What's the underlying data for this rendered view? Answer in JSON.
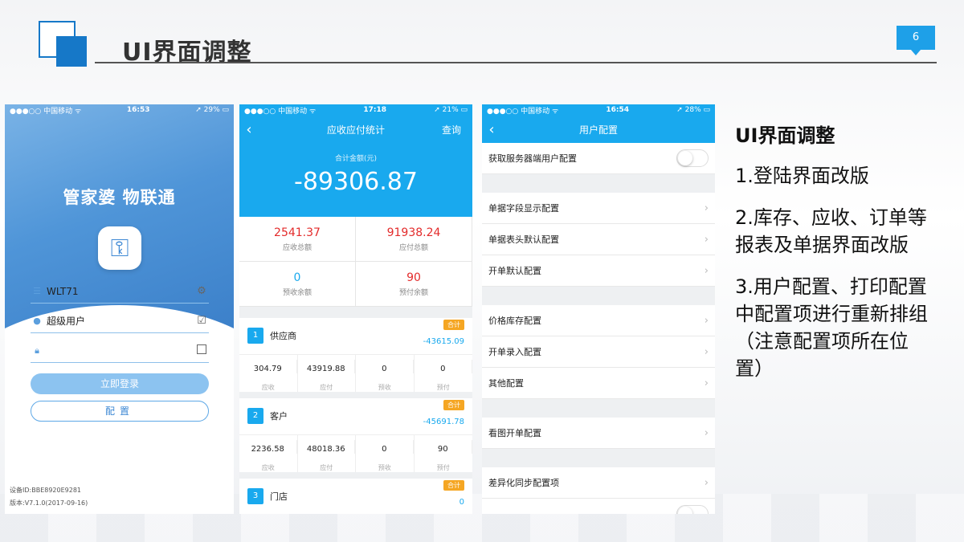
{
  "slide": {
    "title": "UI界面调整",
    "page": "6"
  },
  "login": {
    "status": {
      "carrier": "●●●○○ 中国移动 ᯤ",
      "time": "16:53",
      "battery": "➚ 29% ▭"
    },
    "brand": "管家婆 物联通",
    "username": "WLT71",
    "role": "超级用户",
    "password": "",
    "login_button": "立即登录",
    "config_button": "配置",
    "device_id": "设备ID:BBE8920E9281",
    "version": "版本:V7.1.0(2017-09-16)"
  },
  "stats": {
    "status": {
      "carrier": "●●●○○ 中国移动 ᯤ",
      "time": "17:18",
      "battery": "➚ 21% ▭"
    },
    "title": "应收应付统计",
    "query": "查询",
    "total_label": "合计金额(元)",
    "total_value": "-89306.87",
    "summary": [
      {
        "value": "2541.37",
        "label": "应收总额"
      },
      {
        "value": "91938.24",
        "label": "应付总额"
      },
      {
        "value": "0",
        "label": "预收余额"
      },
      {
        "value": "90",
        "label": "预付余额"
      }
    ],
    "cards": [
      {
        "index": "1",
        "name": "供应商",
        "tag": "合计",
        "total": "-43615.09",
        "cols": [
          {
            "v": "304.79",
            "l": "应收"
          },
          {
            "v": "43919.88",
            "l": "应付"
          },
          {
            "v": "0",
            "l": "预收"
          },
          {
            "v": "0",
            "l": "预付"
          }
        ]
      },
      {
        "index": "2",
        "name": "客户",
        "tag": "合计",
        "total": "-45691.78",
        "cols": [
          {
            "v": "2236.58",
            "l": "应收"
          },
          {
            "v": "48018.36",
            "l": "应付"
          },
          {
            "v": "0",
            "l": "预收"
          },
          {
            "v": "90",
            "l": "预付"
          }
        ]
      },
      {
        "index": "3",
        "name": "门店",
        "tag": "合计",
        "total": "0"
      }
    ]
  },
  "settings": {
    "status": {
      "carrier": "●●●○○ 中国移动 ᯤ",
      "time": "16:54",
      "battery": "➚ 28% ▭"
    },
    "title": "用户配置",
    "items": {
      "server": "获取服务器端用户配置",
      "field_display": "单据字段显示配置",
      "header_default": "单据表头默认配置",
      "order_default": "开单默认配置",
      "price_stock": "价格库存配置",
      "order_entry": "开单录入配置",
      "other": "其他配置",
      "view_order": "看图开单配置",
      "diff_sync": "差异化同步配置项"
    }
  },
  "notes": {
    "heading": "UI界面调整",
    "p1": "1.登陆界面改版",
    "p2": "2.库存、应收、订单等报表及单据界面改版",
    "p3": "3.用户配置、打印配置中配置项进行重新排组（注意配置项所在位置）"
  }
}
